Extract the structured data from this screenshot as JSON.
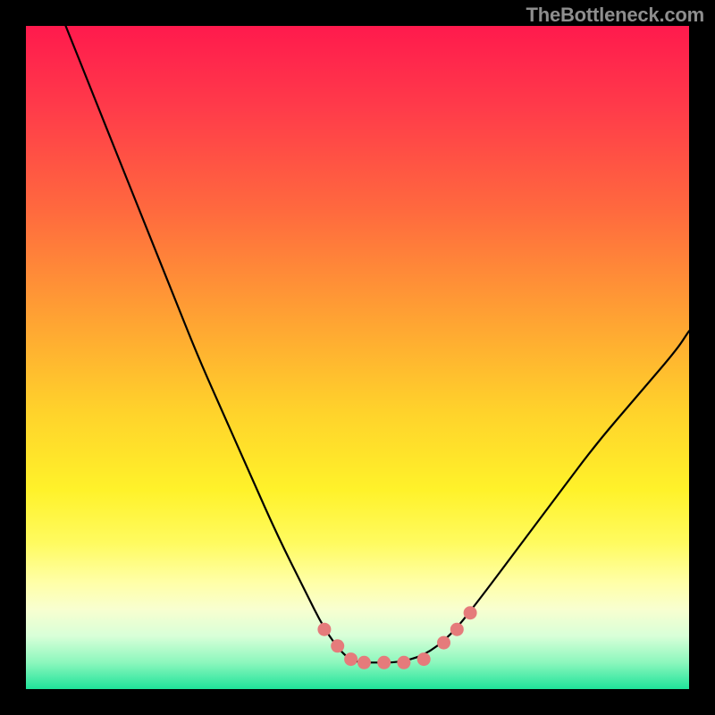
{
  "watermark": "TheBottleneck.com",
  "chart_data": {
    "type": "line",
    "title": "",
    "xlabel": "",
    "ylabel": "",
    "xlim": [
      0,
      100
    ],
    "ylim": [
      0,
      100
    ],
    "series": [
      {
        "name": "curve",
        "x": [
          6,
          10,
          14,
          18,
          22,
          26,
          30,
          34,
          38,
          42,
          45,
          48,
          50,
          53,
          56,
          60,
          64,
          68,
          74,
          80,
          86,
          92,
          98,
          100
        ],
        "y": [
          100,
          90,
          80,
          70,
          60,
          50,
          41,
          32,
          23,
          15,
          9,
          5,
          4,
          4,
          4,
          5,
          8,
          13,
          21,
          29,
          37,
          44,
          51,
          54
        ]
      }
    ],
    "markers": {
      "name": "highlight-dots",
      "color": "#e57b7b",
      "points": [
        {
          "x": 45,
          "y": 9
        },
        {
          "x": 47,
          "y": 6.5
        },
        {
          "x": 49,
          "y": 4.5
        },
        {
          "x": 51,
          "y": 4
        },
        {
          "x": 54,
          "y": 4
        },
        {
          "x": 57,
          "y": 4
        },
        {
          "x": 60,
          "y": 4.5
        },
        {
          "x": 63,
          "y": 7
        },
        {
          "x": 65,
          "y": 9
        },
        {
          "x": 67,
          "y": 11.5
        }
      ]
    }
  }
}
